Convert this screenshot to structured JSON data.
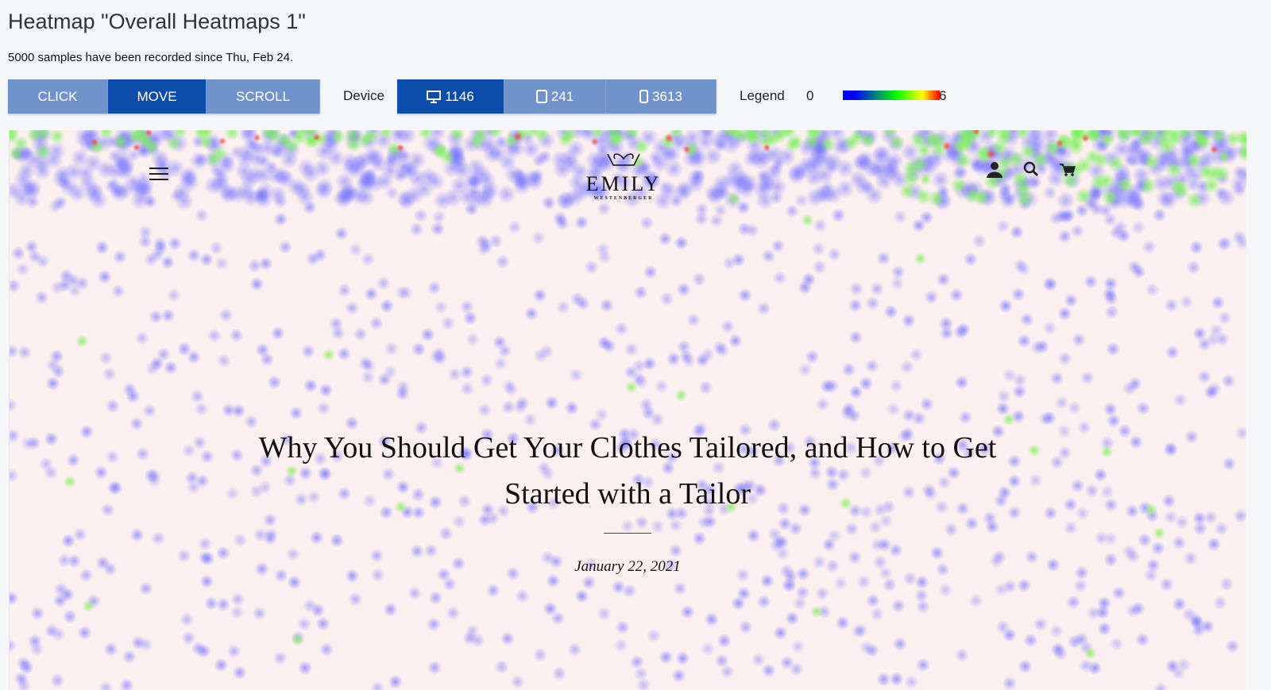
{
  "header": {
    "title": "Heatmap \"Overall Heatmaps 1\"",
    "subtitle": "5000 samples have been recorded since Thu, Feb 24."
  },
  "modes": [
    {
      "label": "CLICK",
      "active": false
    },
    {
      "label": "MOVE",
      "active": true
    },
    {
      "label": "SCROLL",
      "active": false
    }
  ],
  "device": {
    "label": "Device",
    "items": [
      {
        "icon": "desktop-icon",
        "count": "1146",
        "active": true
      },
      {
        "icon": "tablet-icon",
        "count": "241",
        "active": false
      },
      {
        "icon": "phone-icon",
        "count": "3613",
        "active": false
      }
    ]
  },
  "legend": {
    "label": "Legend",
    "min": "0",
    "max": "6",
    "colors": [
      "#0000ff",
      "#00ff00",
      "#ffff00",
      "#ff0000"
    ]
  },
  "site": {
    "logo_name": "EMILY",
    "logo_sub": "WESTENBERGER",
    "article_title": "Why You Should Get Your Clothes Tailored, and How to Get Started with a Tailor",
    "date": "January 22, 2021"
  },
  "colors": {
    "accent": "#0c4dac",
    "inactive": "#7093cc",
    "page_bg": "#fcefef"
  }
}
